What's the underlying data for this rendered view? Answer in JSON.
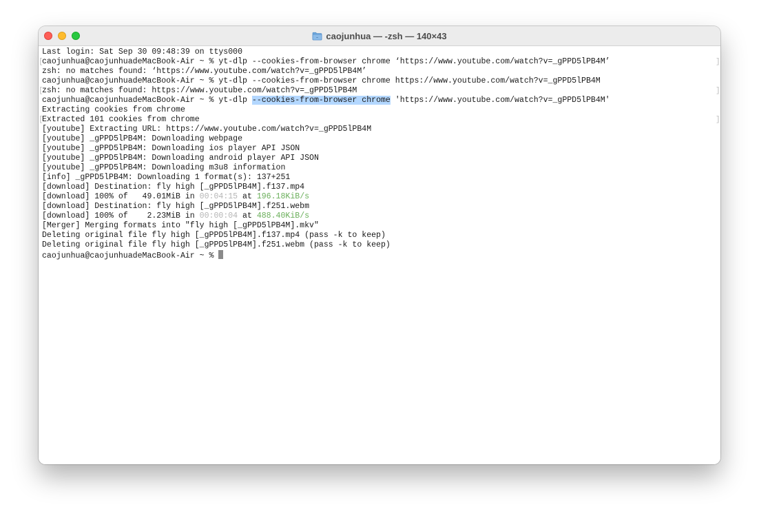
{
  "window": {
    "title": "caojunhua — -zsh — 140×43"
  },
  "terminal": {
    "login": "Last login: Sat Sep 30 09:48:39 on ttys000",
    "prompt": "caojunhua@caojunhuadeMacBook-Air ~ % ",
    "cmd1": "yt-dlp --cookies-from-browser chrome ‘https://www.youtube.com/watch?v=_gPPD5lPB4M’",
    "err1": "zsh: no matches found: ‘https://www.youtube.com/watch?v=_gPPD5lPB4M’",
    "cmd2": "yt-dlp --cookies-from-browser chrome https://www.youtube.com/watch?v=_gPPD5lPB4M",
    "err2": "zsh: no matches found: https://www.youtube.com/watch?v=_gPPD5lPB4M",
    "cmd3_pre": "yt-dlp ",
    "cmd3_sel": "--cookies-from-browser chrome",
    "cmd3_post": " 'https://www.youtube.com/watch?v=_gPPD5lPB4M'",
    "out1": "Extracting cookies from chrome",
    "out2": "Extracted 101 cookies from chrome",
    "out3": "[youtube] Extracting URL: https://www.youtube.com/watch?v=_gPPD5lPB4M",
    "out4": "[youtube] _gPPD5lPB4M: Downloading webpage",
    "out5": "[youtube] _gPPD5lPB4M: Downloading ios player API JSON",
    "out6": "[youtube] _gPPD5lPB4M: Downloading android player API JSON",
    "out7": "[youtube] _gPPD5lPB4M: Downloading m3u8 information",
    "out8": "[info] _gPPD5lPB4M: Downloading 1 format(s): 137+251",
    "out9": "[download] Destination: fly high [_gPPD5lPB4M].f137.mp4",
    "dl1_pre": "[download] 100% of   49.01MiB in ",
    "dl1_time": "00:04:15",
    "dl1_mid": " at ",
    "dl1_rate": "196.18KiB/s",
    "out10": "[download] Destination: fly high [_gPPD5lPB4M].f251.webm",
    "dl2_pre": "[download] 100% of    2.23MiB in ",
    "dl2_time": "00:00:04",
    "dl2_mid": " at ",
    "dl2_rate": "488.40KiB/s",
    "out11": "[Merger] Merging formats into \"fly high [_gPPD5lPB4M].mkv\"",
    "out12": "Deleting original file fly high [_gPPD5lPB4M].f137.mp4 (pass -k to keep)",
    "out13": "Deleting original file fly high [_gPPD5lPB4M].f251.webm (pass -k to keep)",
    "bracket_left": "[",
    "bracket_right": "]"
  },
  "colors": {
    "selection": "#b3d7ff",
    "dim_time": "#b5b5b5",
    "rate_green": "#6aaf5a",
    "close": "#fe5f57",
    "minimize": "#febc2e",
    "zoom": "#28c840"
  },
  "icons": {
    "title_icon": "folder-icon"
  }
}
